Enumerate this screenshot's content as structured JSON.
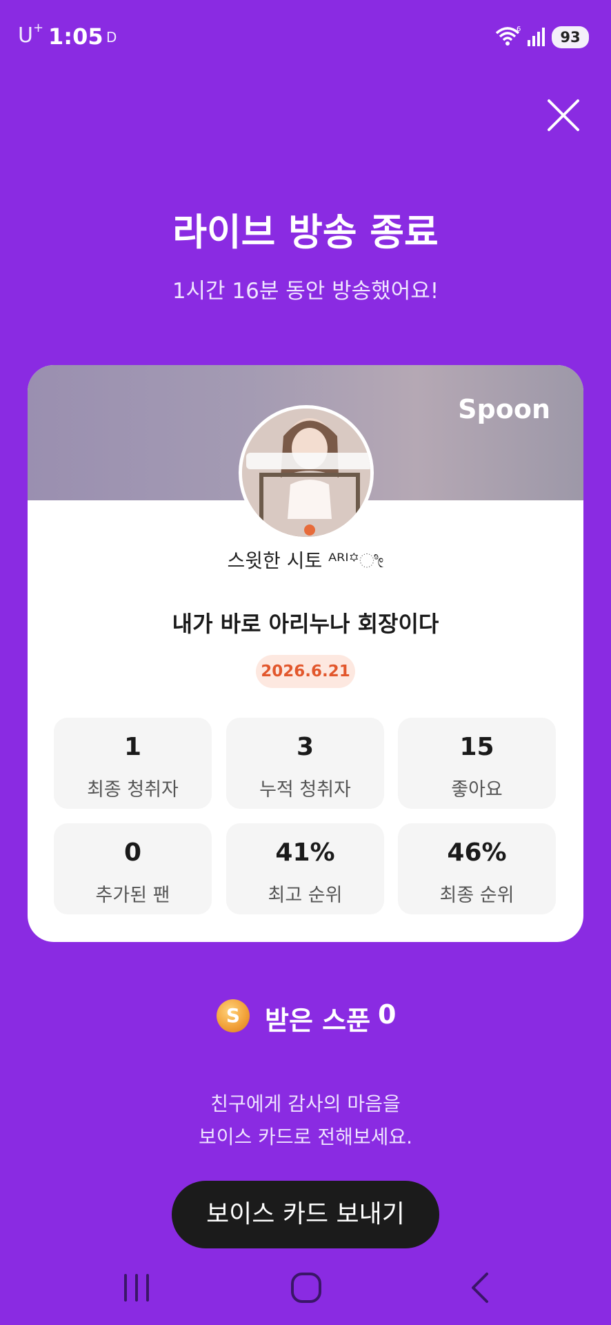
{
  "status_bar": {
    "carrier": "U",
    "carrier_sup": "+",
    "time": "1:05",
    "dnd_indicator": "D",
    "wifi_badge": "6",
    "battery": "93"
  },
  "header": {
    "close_icon": "close-icon",
    "title": "라이브 방송 종료",
    "subtitle": "1시간 16분 동안 방송했어요!"
  },
  "card": {
    "brand": "Spoon",
    "host_name": "스윗한 시토 ᴬᴿᴵ꙳ೀ",
    "room_title": "내가 바로 아리누나 회장이다",
    "date": "2026.6.21",
    "stats": [
      {
        "value": "1",
        "label": "최종 청취자"
      },
      {
        "value": "3",
        "label": "누적 청취자"
      },
      {
        "value": "15",
        "label": "좋아요"
      },
      {
        "value": "0",
        "label": "추가된 팬"
      },
      {
        "value": "41%",
        "label": "최고 순위"
      },
      {
        "value": "46%",
        "label": "최종 순위"
      }
    ]
  },
  "spoons": {
    "coin_letter": "S",
    "label": "받은 스푼",
    "count": "0"
  },
  "message": {
    "line1": "친구에게 감사의 마음을",
    "line2": "보이스 카드로 전해보세요."
  },
  "send_button": "보이스 카드 보내기",
  "colors": {
    "background": "#8a2be2",
    "date_badge_bg": "#fde8e0",
    "date_badge_text": "#e2572c",
    "button_bg": "#1b1b1b"
  }
}
